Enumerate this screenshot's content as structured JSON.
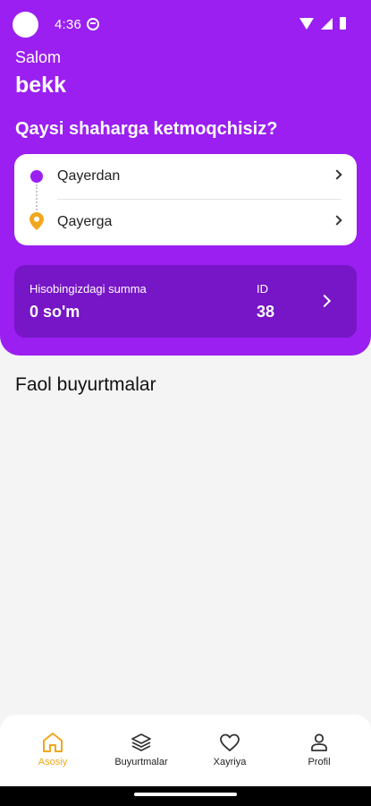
{
  "status_bar": {
    "time": "4:36"
  },
  "header": {
    "greeting": "Salom",
    "username": "bekk",
    "question": "Qaysi shaharga ketmoqchisiz?"
  },
  "route": {
    "from_label": "Qayerdan",
    "to_label": "Qayerga"
  },
  "balance": {
    "label": "Hisobingizdagi summa",
    "value": "0 so'm",
    "id_label": "ID",
    "id_value": "38"
  },
  "main": {
    "section_title": "Faol buyurtmalar"
  },
  "bottom_nav": {
    "items": [
      {
        "label": "Asosiy",
        "icon": "home-icon"
      },
      {
        "label": "Buyurtmalar",
        "icon": "layers-icon"
      },
      {
        "label": "Xayriya",
        "icon": "heart-icon"
      },
      {
        "label": "Profil",
        "icon": "user-icon"
      }
    ],
    "active_index": 0
  },
  "colors": {
    "primary": "#9a1ff0",
    "primary_dark": "#7616c6",
    "accent": "#f0a71c",
    "background": "#f4f4f4"
  }
}
